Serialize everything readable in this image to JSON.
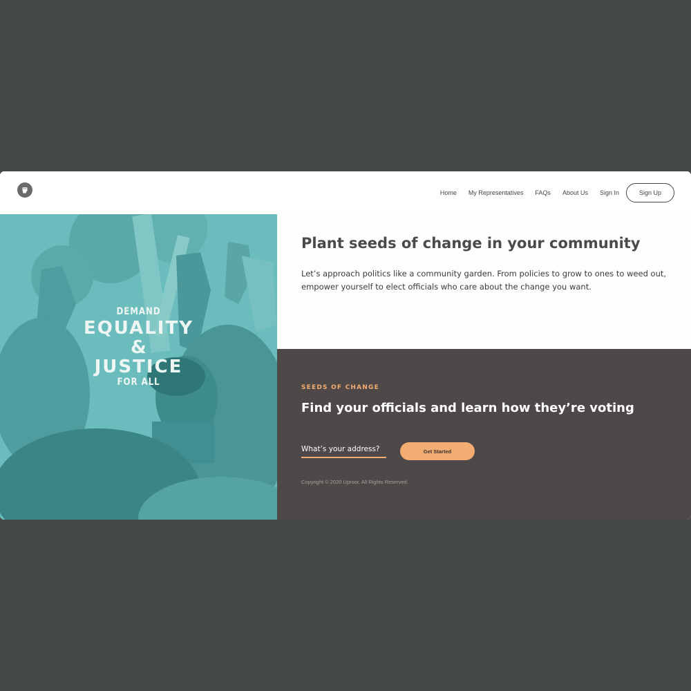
{
  "nav": {
    "links": [
      "Home",
      "My Representatives",
      "FAQs",
      "About Us",
      "Sign In"
    ],
    "signup_label": "Sign Up"
  },
  "hero": {
    "poster": {
      "line1": "DEMAND",
      "line2": "EQUALITY",
      "line3": "&",
      "line4": "JUSTICE",
      "line5": "FOR ALL"
    }
  },
  "intro": {
    "title": "Plant seeds of change in your community",
    "body": "Let’s approach politics like a community garden. From policies to grow to ones to weed out, empower yourself to elect officials who care about the change you want."
  },
  "cta": {
    "eyebrow": "SEEDS OF CHANGE",
    "title": "Find your officials and learn how they’re voting",
    "address_placeholder": "What’s your address?",
    "button_label": "Get Started",
    "copyright": "Copyright © 2020 Uproot. All Rights Reserved."
  },
  "colors": {
    "background": "#434949",
    "accent": "#f3ad72",
    "teal": "#6bbcbc",
    "dark_panel": "#4e4948"
  },
  "icons": {
    "logo": "raised-fist-icon"
  }
}
